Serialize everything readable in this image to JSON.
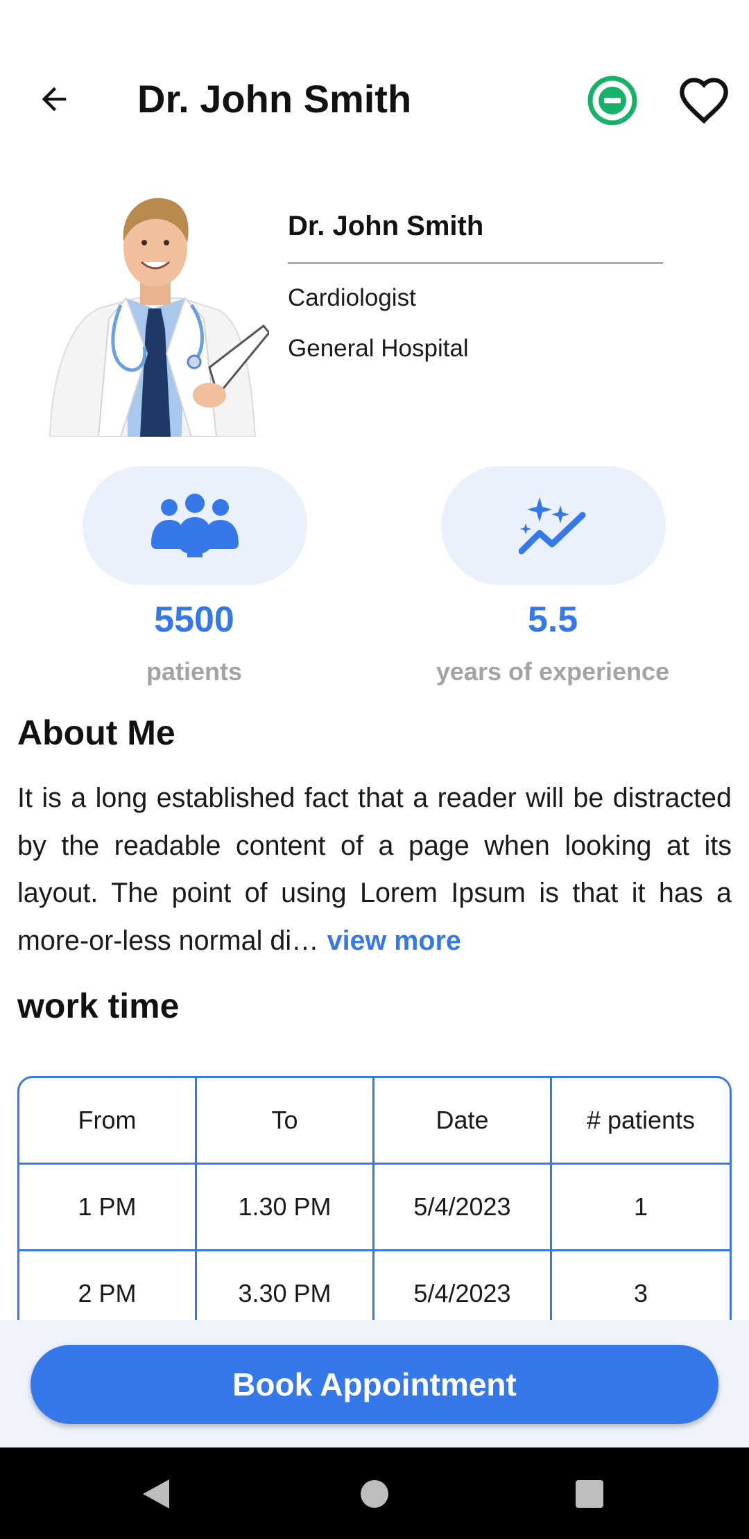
{
  "header": {
    "title": "Dr. John Smith",
    "status_icon": "minus-circle-icon",
    "status_color": "#17b26a",
    "favorite_icon": "heart-outline-icon",
    "back_icon": "arrow-left-icon"
  },
  "profile": {
    "name": "Dr. John Smith",
    "specialty": "Cardiologist",
    "hospital": "General Hospital",
    "avatar_icon": "doctor-photo"
  },
  "stats": [
    {
      "icon": "group-icon",
      "value": "5500",
      "label": "patients"
    },
    {
      "icon": "sparkle-chart-icon",
      "value": "5.5",
      "label": "years of experience"
    }
  ],
  "about": {
    "title": "About Me",
    "text": "It is a long established fact that a reader will be distracted by the readable content of a page when looking at its layout. The point of using Lorem Ipsum is that it has a more-or-less normal di…",
    "view_more": "view more"
  },
  "work_time": {
    "title": "work time",
    "columns": [
      "From",
      "To",
      "Date",
      "# patients"
    ],
    "rows": [
      [
        "1 PM",
        "1.30 PM",
        "5/4/2023",
        "1"
      ],
      [
        "2 PM",
        "3.30 PM",
        "5/4/2023",
        "3"
      ]
    ]
  },
  "actions": {
    "book_label": "Book Appointment"
  },
  "colors": {
    "accent": "#3478ea",
    "pill_bg": "#eaf0fc",
    "muted_text": "#a3a3a3"
  },
  "system_nav": {
    "back": "nav-back-icon",
    "home": "nav-home-icon",
    "recents": "nav-recents-icon"
  }
}
